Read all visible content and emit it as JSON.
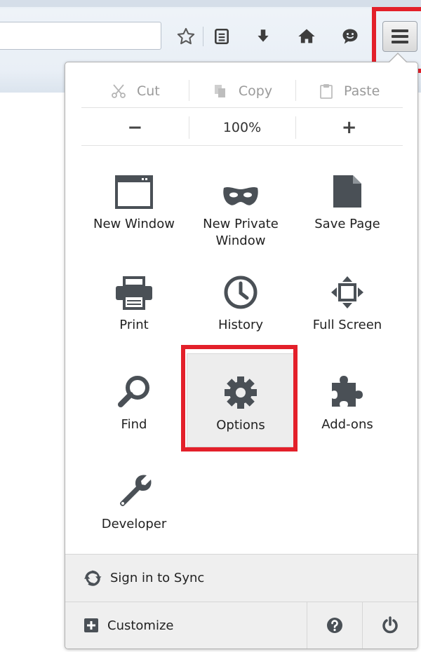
{
  "edit": {
    "cut": {
      "label": "Cut",
      "icon": "scissors-icon"
    },
    "copy": {
      "label": "Copy",
      "icon": "copy-icon"
    },
    "paste": {
      "label": "Paste",
      "icon": "clipboard-icon"
    }
  },
  "zoom": {
    "decrease": "−",
    "level": "100%",
    "increase": "+"
  },
  "grid": [
    {
      "label": "New Window",
      "icon": "window-icon"
    },
    {
      "label": "New Private\nWindow",
      "icon": "mask-icon"
    },
    {
      "label": "Save Page",
      "icon": "page-icon"
    },
    {
      "label": "Print",
      "icon": "printer-icon"
    },
    {
      "label": "History",
      "icon": "clock-icon"
    },
    {
      "label": "Full Screen",
      "icon": "fullscreen-icon"
    },
    {
      "label": "Find",
      "icon": "magnifier-icon"
    },
    {
      "label": "Options",
      "icon": "gear-icon"
    },
    {
      "label": "Add-ons",
      "icon": "puzzle-icon"
    },
    {
      "label": "Developer",
      "icon": "wrench-icon"
    }
  ],
  "footer": {
    "sync": "Sign in to Sync",
    "customize": "Customize"
  },
  "colors": {
    "highlight": "#e3202a",
    "icon": "#4a5056"
  }
}
